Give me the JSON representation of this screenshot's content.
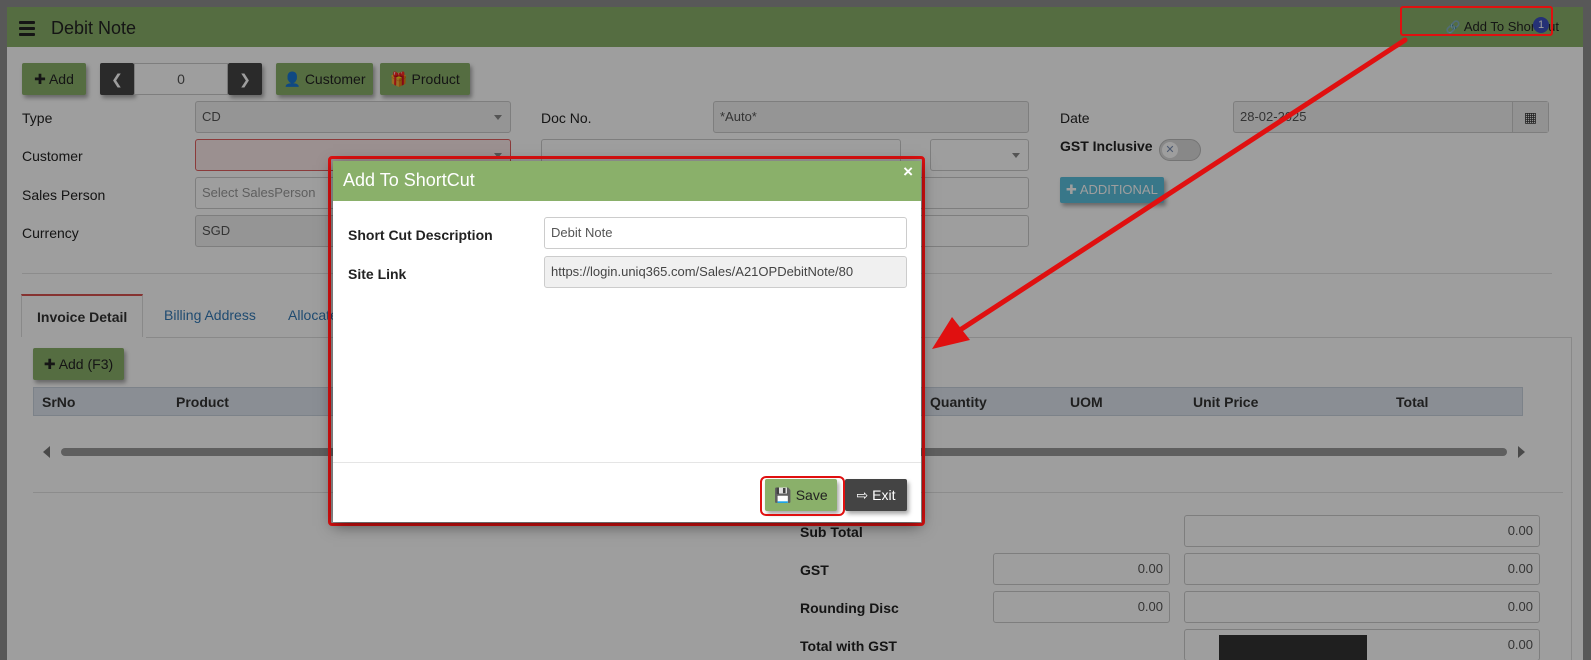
{
  "app": {
    "title": "Debit Note",
    "shortcut_link": "Add To ShortCut",
    "shortcut_badge": "1"
  },
  "toolbar": {
    "add_label": "Add",
    "pager_value": "0",
    "customer_label": "Customer",
    "product_label": "Product"
  },
  "form": {
    "type_label": "Type",
    "type_value": "CD",
    "docno_label": "Doc No.",
    "docno_value": "*Auto*",
    "date_label": "Date",
    "date_value": "28-02-2025",
    "customer_label": "Customer",
    "gst_inclusive_label": "GST Inclusive",
    "sales_person_label": "Sales Person",
    "sales_person_placeholder": "Select SalesPerson",
    "currency_label": "Currency",
    "currency_value": "SGD",
    "additional_label": "ADDITIONAL"
  },
  "tabs": [
    {
      "label": "Invoice Detail"
    },
    {
      "label": "Billing Address"
    },
    {
      "label": "Allocate"
    }
  ],
  "grid": {
    "add_label": "Add (F3)",
    "columns": [
      "SrNo",
      "Product",
      "Quantity",
      "UOM",
      "Unit Price",
      "Total"
    ]
  },
  "totals": {
    "sub_total_label": "Sub Total",
    "sub_total_value": "0.00",
    "gst_label": "GST",
    "gst_rate": "0.00",
    "gst_value": "0.00",
    "rounding_label": "Rounding Disc",
    "rounding_rate": "0.00",
    "rounding_value": "0.00",
    "total_gst_label": "Total with GST",
    "total_gst_value": "0.00"
  },
  "modal": {
    "title": "Add To ShortCut",
    "close": "×",
    "desc_label": "Short Cut Description",
    "desc_value": "Debit Note",
    "link_label": "Site Link",
    "link_value": "https://login.uniq365.com/Sales/A21OPDebitNote/80",
    "save_label": "Save",
    "exit_label": "Exit"
  },
  "colors": {
    "brand_green": "#8ab06a",
    "highlight_red": "#e01010",
    "link_blue": "#337ab7"
  }
}
